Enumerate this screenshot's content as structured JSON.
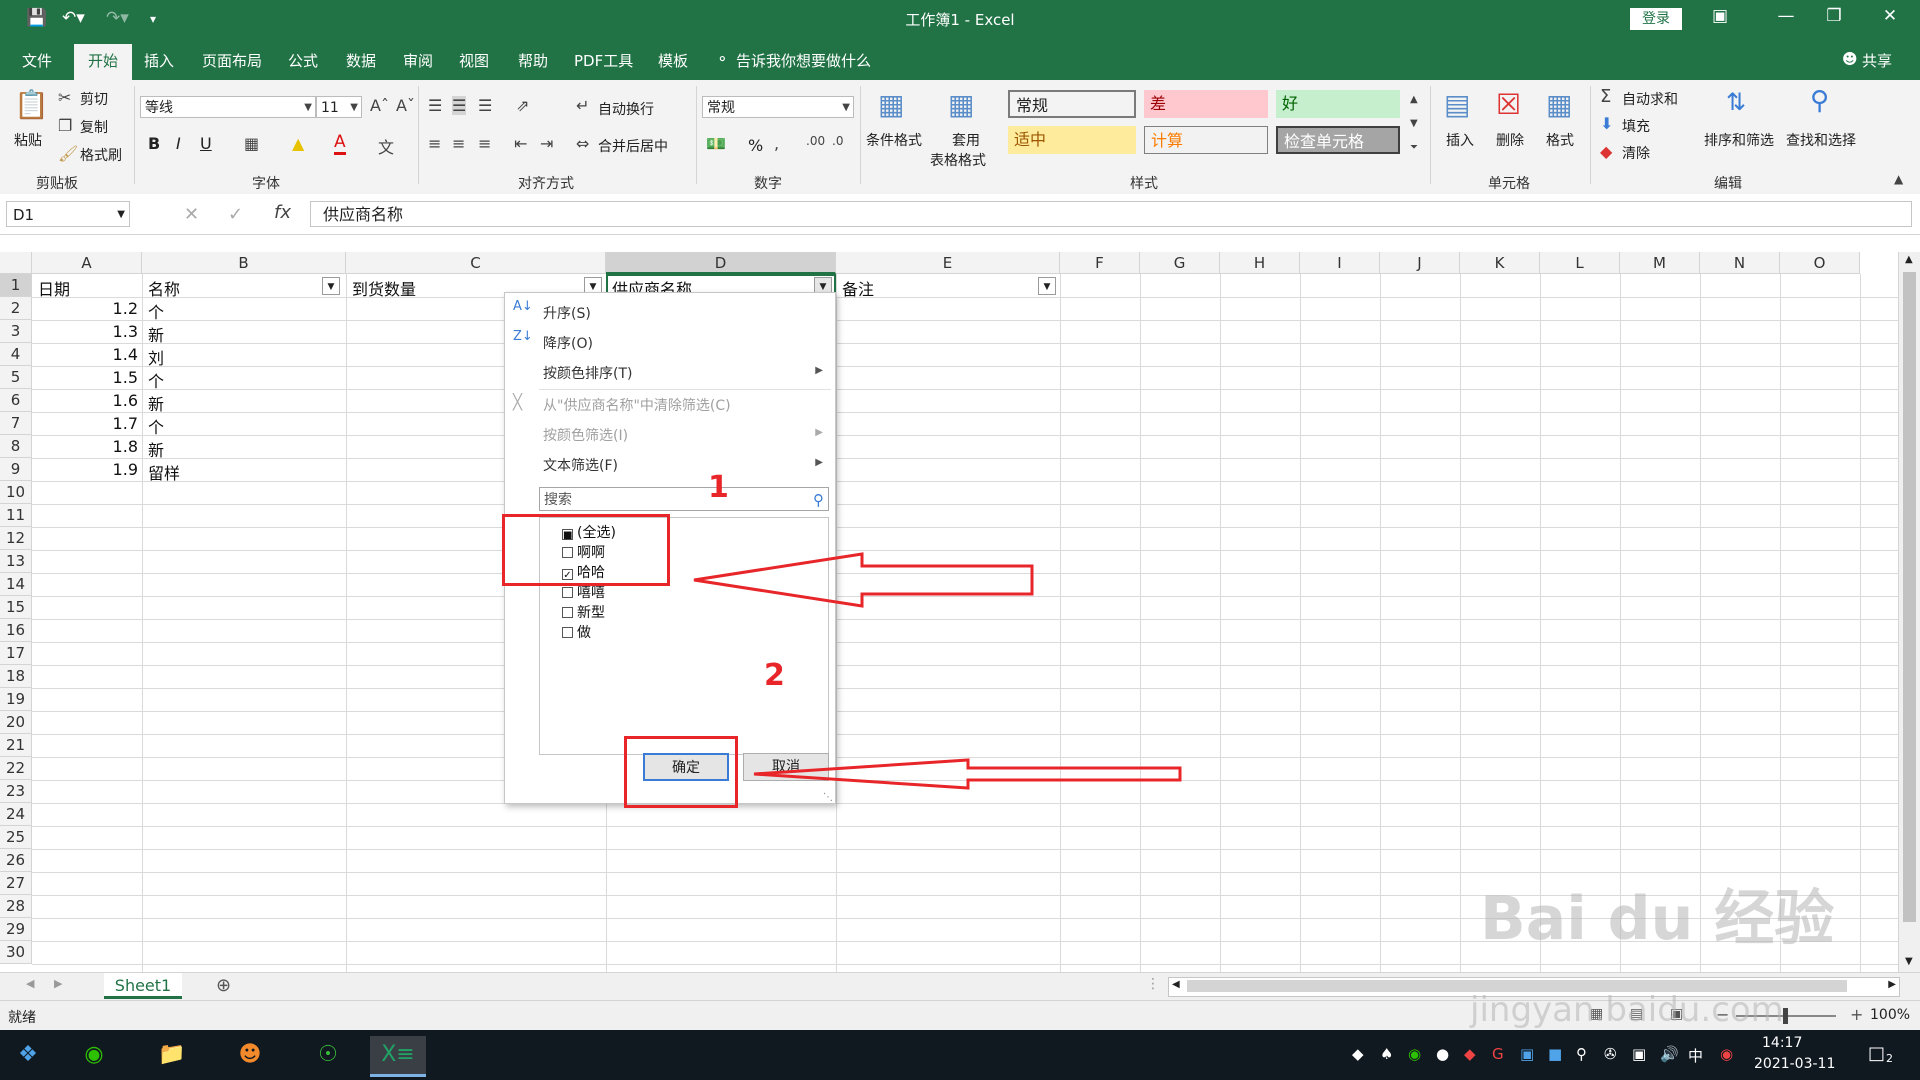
{
  "titlebar": {
    "title": "工作簿1 - Excel",
    "login": "登录",
    "save_icon": "save-icon",
    "undo_icon": "undo-icon",
    "redo_icon": "redo-icon"
  },
  "menu": {
    "items": [
      "文件",
      "开始",
      "插入",
      "页面布局",
      "公式",
      "数据",
      "审阅",
      "视图",
      "帮助",
      "PDF工具",
      "模板"
    ],
    "tell_me": "告诉我你想要做什么",
    "share": "共享"
  },
  "ribbon": {
    "clipboard": {
      "paste": "粘贴",
      "cut": "剪切",
      "copy": "复制",
      "format_painter": "格式刷",
      "group": "剪贴板"
    },
    "font": {
      "name": "等线",
      "size": "11",
      "bold": "B",
      "italic": "I",
      "underline": "U",
      "font_color": "A",
      "group": "字体"
    },
    "alignment": {
      "wrap": "自动换行",
      "merge": "合并后居中",
      "group": "对齐方式"
    },
    "number": {
      "format": "常规",
      "percent": "%",
      "group": "数字"
    },
    "styles": {
      "conditional": "条件格式",
      "table1": "套用",
      "table2": "表格格式",
      "group": "样式",
      "cells": [
        {
          "label": "常规",
          "bg": "#ffffff",
          "color": "#111111"
        },
        {
          "label": "差",
          "bg": "#ffc7ce",
          "color": "#9c0006"
        },
        {
          "label": "好",
          "bg": "#c6efce",
          "color": "#006100"
        },
        {
          "label": "适中",
          "bg": "#ffeb9c",
          "color": "#9c5700"
        },
        {
          "label": "计算",
          "bg": "#f2f2f2",
          "color": "#fa7d00"
        },
        {
          "label": "检查单元格",
          "bg": "#a5a5a5",
          "color": "#ffffff"
        }
      ]
    },
    "cells": {
      "insert": "插入",
      "delete": "删除",
      "format": "格式",
      "group": "单元格"
    },
    "editing": {
      "autosum": "自动求和",
      "fill": "填充",
      "clear": "清除",
      "sort": "排序和筛选",
      "find": "查找和选择",
      "group": "编辑"
    }
  },
  "formula_bar": {
    "name_box": "D1",
    "value": "供应商名称"
  },
  "grid": {
    "columns": [
      "A",
      "B",
      "C",
      "D",
      "E",
      "F",
      "G",
      "H",
      "I",
      "J",
      "K",
      "L",
      "M",
      "N",
      "O"
    ],
    "rows": [
      "1",
      "2",
      "3",
      "4",
      "5",
      "6",
      "7",
      "8",
      "9",
      "10",
      "11",
      "12",
      "13",
      "14",
      "15",
      "16",
      "17",
      "18",
      "19",
      "20",
      "21",
      "22",
      "23",
      "24",
      "25",
      "26",
      "27",
      "28",
      "29",
      "30"
    ],
    "headers": [
      "日期",
      "名称",
      "到货数量",
      "供应商名称",
      "备注"
    ],
    "data": [
      [
        "1.2",
        "个"
      ],
      [
        "1.3",
        "新"
      ],
      [
        "1.4",
        "刘"
      ],
      [
        "1.5",
        "个"
      ],
      [
        "1.6",
        "新"
      ],
      [
        "1.7",
        "个"
      ],
      [
        "1.8",
        "新"
      ],
      [
        "1.9",
        "留样"
      ]
    ]
  },
  "filter_dropdown": {
    "sort_asc": "升序(S)",
    "sort_desc": "降序(O)",
    "sort_color": "按颜色排序(T)",
    "clear_filter": "从\"供应商名称\"中清除筛选(C)",
    "filter_color": "按颜色筛选(I)",
    "text_filter": "文本筛选(F)",
    "search_placeholder": "搜索",
    "options": [
      {
        "label": "(全选)",
        "state": "partial"
      },
      {
        "label": "啊啊",
        "state": "unchecked"
      },
      {
        "label": "哈哈",
        "state": "checked"
      },
      {
        "label": "嘻嘻",
        "state": "unchecked"
      },
      {
        "label": "新型",
        "state": "unchecked"
      },
      {
        "label": "做",
        "state": "unchecked"
      }
    ],
    "ok": "确定",
    "cancel": "取消"
  },
  "annotations": {
    "step1": "1",
    "step2": "2",
    "color": "#e8262a"
  },
  "sheet_tabs": {
    "active": "Sheet1"
  },
  "status": {
    "ready": "就绪",
    "zoom": "100%"
  },
  "taskbar": {
    "time": "14:17",
    "date": "2021-03-11",
    "ime": "中",
    "notifications": "2"
  },
  "watermark": {
    "brand": "Bai du 经验",
    "url": "jingyan.baidu.com"
  }
}
